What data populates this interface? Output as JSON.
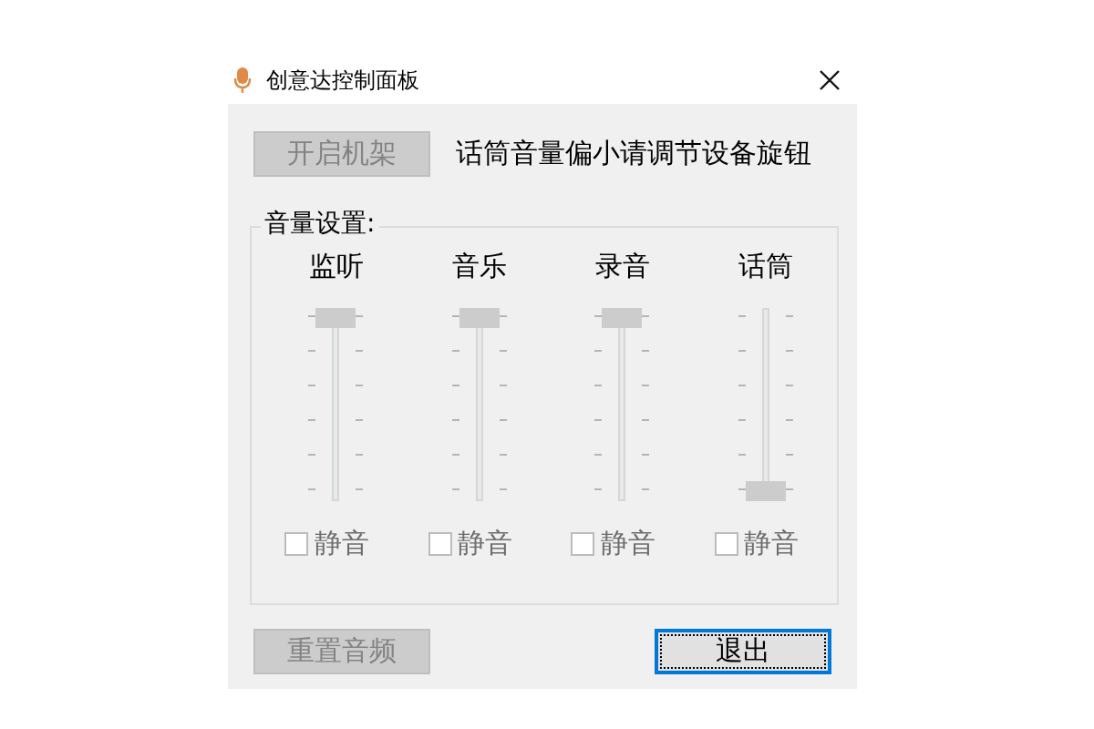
{
  "window": {
    "title": "创意达控制面板"
  },
  "rack_button": {
    "label": "开启机架",
    "disabled": true
  },
  "hint": "话筒音量偏小请调节设备旋钮",
  "volume_group": {
    "title": "音量设置:",
    "channels": [
      {
        "name": "监听",
        "level": 1,
        "mute": {
          "label": "静音",
          "checked": false,
          "disabled": true
        }
      },
      {
        "name": "音乐",
        "level": 1,
        "mute": {
          "label": "静音",
          "checked": false,
          "disabled": true
        }
      },
      {
        "name": "录音",
        "level": 1,
        "mute": {
          "label": "静音",
          "checked": false,
          "disabled": true
        }
      },
      {
        "name": "话筒",
        "level": 0,
        "mute": {
          "label": "静音",
          "checked": false,
          "disabled": true
        }
      }
    ]
  },
  "reset_button": {
    "label": "重置音频",
    "disabled": true
  },
  "exit_button": {
    "label": "退出",
    "focused": true
  }
}
